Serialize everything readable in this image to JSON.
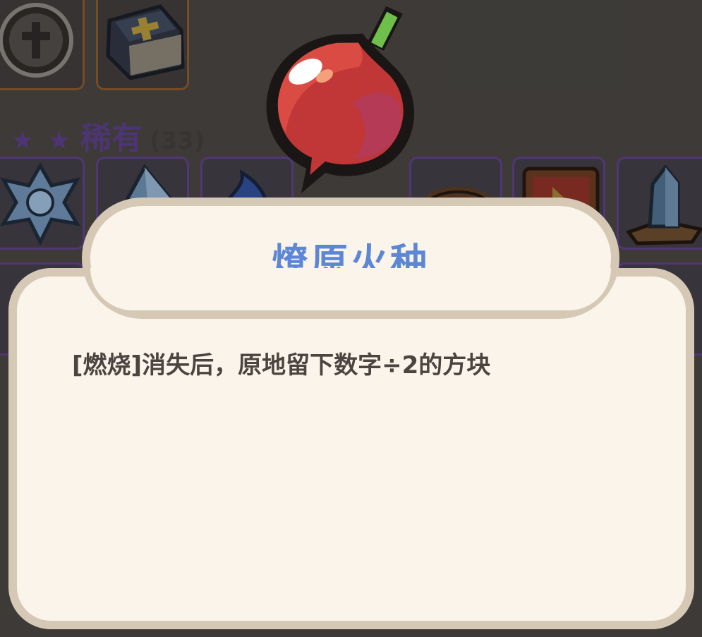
{
  "background": {
    "section": {
      "stars": "★ ★",
      "label": "稀有",
      "count": "(33)"
    }
  },
  "popup": {
    "title": "燎原火种",
    "description": "[燃烧]消失后，原地留下数字÷2的方块"
  },
  "colors": {
    "title": "#5c87d4",
    "panel": "#fbf4ea",
    "panel_border": "#d5c9b6",
    "rarity": "#5a3e8a",
    "background": "#464441"
  },
  "icons": {
    "featured_item": "red-gourd-icon",
    "grid_items": [
      "cross-coin-icon",
      "holy-book-icon",
      "ice-crystal-emblem-icon",
      "blue-crystal-icon",
      "blue-flame-icon",
      "bronze-ring-icon",
      "red-shield-icon",
      "crystal-pillar-icon"
    ]
  }
}
